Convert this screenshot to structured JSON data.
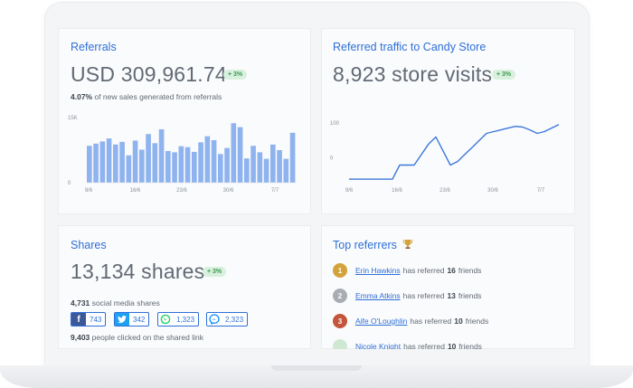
{
  "referrals": {
    "title": "Referrals",
    "amount": "USD 309,961.74",
    "badge": "+ 3%",
    "sub_pct": "4.07%",
    "sub_text": "of new sales generated from referrals"
  },
  "traffic": {
    "title": "Referred traffic to Candy Store",
    "visits": "8,923 store visits",
    "badge": "+ 3%"
  },
  "shares": {
    "title": "Shares",
    "total": "13,134 shares",
    "badge": "+ 3%",
    "social_count": "4,731",
    "social_text": "social media shares",
    "clicked_count": "9,403",
    "clicked_text": "people clicked on the shared link",
    "networks": [
      {
        "name": "facebook",
        "count": "743",
        "color": "#3b5998"
      },
      {
        "name": "twitter",
        "count": "342",
        "color": "#1da1f2"
      },
      {
        "name": "whatsapp",
        "count": "1,323",
        "color": "#25d366"
      },
      {
        "name": "messenger",
        "count": "2,323",
        "color": "#0084ff"
      }
    ]
  },
  "top_referrers": {
    "title": "Top referrers",
    "trophy_icon": "trophy-icon",
    "mid_text": "has referred",
    "end_text": "friends",
    "rows": [
      {
        "rank": "1",
        "name": "Erin Hawkins",
        "count": "16",
        "medal_color": "#d4a23a"
      },
      {
        "rank": "2",
        "name": "Emma Atkins",
        "count": "13",
        "medal_color": "#a9adb3"
      },
      {
        "rank": "3",
        "name": "Aife O'Loughlin",
        "count": "10",
        "medal_color": "#c4553c"
      },
      {
        "rank": "",
        "name": "Nicole Knight",
        "count": "10",
        "medal_color": "#cfe8d3"
      }
    ]
  },
  "chart_data": [
    {
      "type": "bar",
      "x_ticks": [
        "9/6",
        "16/6",
        "23/6",
        "30/6",
        "7/7"
      ],
      "y_ticks": [
        "15K",
        "0"
      ],
      "ylim": [
        0,
        15000
      ],
      "values": [
        8500,
        9000,
        9500,
        10200,
        8800,
        9400,
        6300,
        9700,
        7600,
        11200,
        9100,
        12300,
        7300,
        7000,
        8400,
        8200,
        7100,
        9300,
        10700,
        9800,
        6600,
        8000,
        13700,
        12800,
        5600,
        8500,
        7000,
        5500,
        8800,
        7500,
        5500,
        11500
      ],
      "color": "#8fb3ef"
    },
    {
      "type": "line",
      "x_ticks": [
        "9/6",
        "16/6",
        "23/6",
        "30/6",
        "7/7"
      ],
      "y_ticks": [
        "100",
        "0"
      ],
      "ylim": [
        -70,
        120
      ],
      "values": [
        -60,
        -60,
        -60,
        -60,
        -60,
        -60,
        -60,
        -20,
        -20,
        -20,
        10,
        40,
        60,
        20,
        -20,
        -10,
        10,
        30,
        50,
        70,
        75,
        80,
        85,
        90,
        88,
        80,
        70,
        75,
        85,
        95
      ],
      "color": "#3d78db"
    }
  ]
}
